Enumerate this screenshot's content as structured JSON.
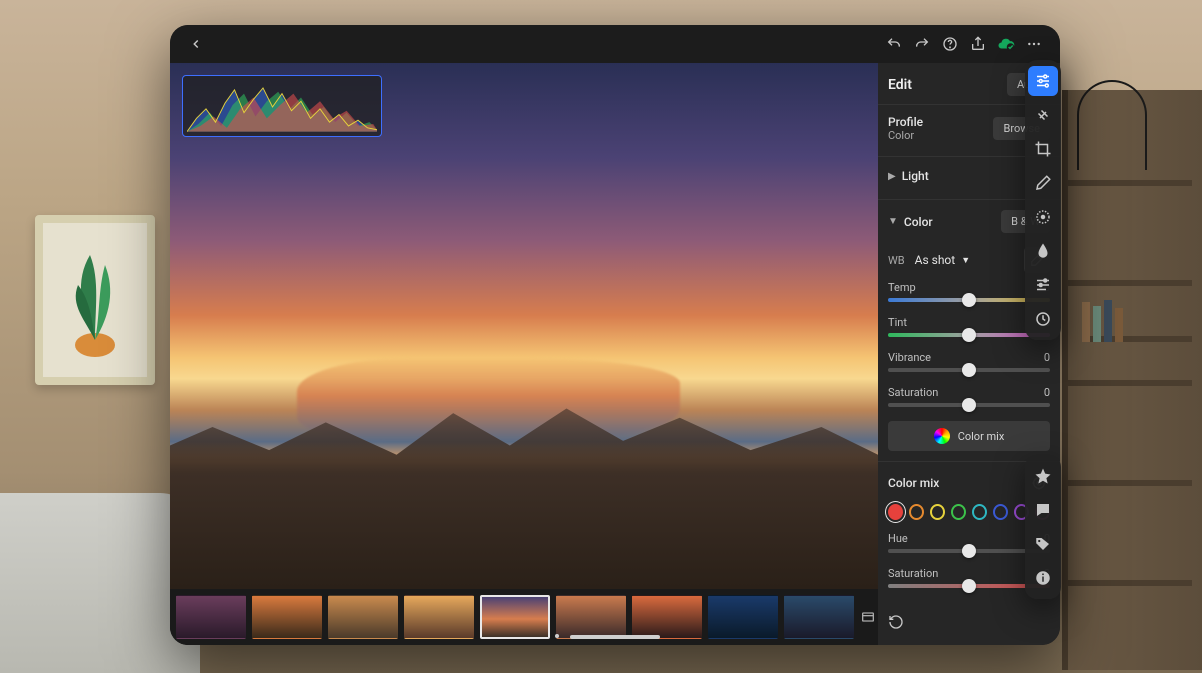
{
  "toolbar": {
    "back": "Back",
    "undo": "Undo",
    "redo": "Redo",
    "help": "Help",
    "share": "Share",
    "sync": "Synced",
    "more": "More"
  },
  "panel": {
    "title": "Edit",
    "auto_label": "Auto",
    "profile": {
      "label": "Profile",
      "value": "Color",
      "browse_label": "Browse"
    },
    "light": {
      "title": "Light"
    },
    "color": {
      "title": "Color",
      "bw_label": "B & W",
      "wb_label": "WB",
      "wb_value": "As shot",
      "sliders": {
        "temp": {
          "label": "Temp",
          "value": 0
        },
        "tint": {
          "label": "Tint",
          "value": 0
        },
        "vibrance": {
          "label": "Vibrance",
          "value": 0
        },
        "saturation": {
          "label": "Saturation",
          "value": 0
        }
      },
      "colormix_btn": "Color mix"
    },
    "colormix": {
      "title": "Color mix",
      "swatches": [
        "#e6413c",
        "#e68a2e",
        "#e6d23c",
        "#3cc24a",
        "#2eb8c2",
        "#3b5ad6",
        "#9b4cd6",
        "#d64ca8"
      ],
      "active_swatch": 0,
      "sliders": {
        "hue": {
          "label": "Hue",
          "value": 0
        },
        "saturation": {
          "label": "Saturation",
          "value": 0
        }
      }
    },
    "reset_label": "Reset"
  },
  "toolrail_top": [
    "adjust",
    "healing",
    "crop",
    "masking",
    "radial",
    "presets",
    "versions",
    "settings"
  ],
  "toolrail_bottom": [
    "rating",
    "comments",
    "keywords",
    "info"
  ],
  "filmstrip": {
    "count": 9,
    "selected": 4
  }
}
